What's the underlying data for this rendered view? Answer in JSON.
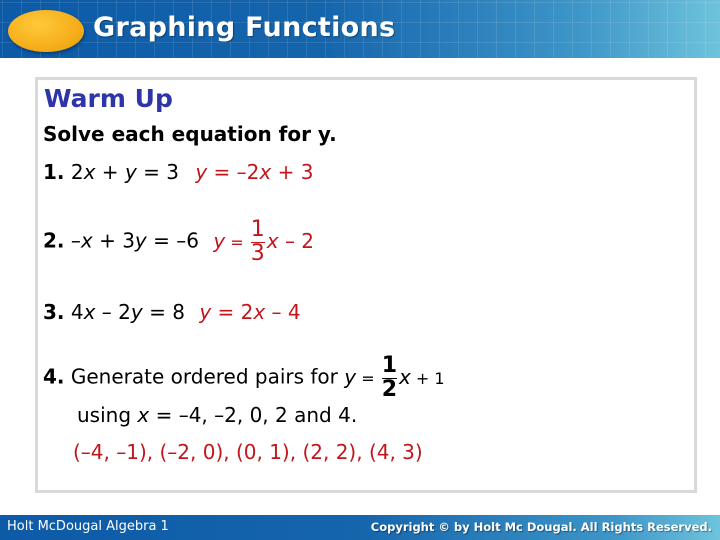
{
  "header": {
    "title": "Graphing Functions",
    "accent_color": "#f6ae1a",
    "bar_color": "#0d5aa7"
  },
  "content": {
    "heading": "Warm Up",
    "instruction": "Solve each equation for y.",
    "problems": [
      {
        "number": "1.",
        "equation": {
          "a": "2",
          "x": "x",
          "b": " + ",
          "y": "y",
          "c": " = 3"
        },
        "answer": {
          "y": "y",
          "rest": " = –2",
          "x": "x",
          "tail": " + 3"
        }
      },
      {
        "number": "2.",
        "equation": {
          "a": "–",
          "x": "x",
          "b": " + 3",
          "y": "y",
          "c": " = –6"
        },
        "answer": {
          "y": "y",
          "eq": " = ",
          "frac_num": "1",
          "frac_den": "3",
          "x": "x",
          "tail": " – 2"
        }
      },
      {
        "number": "3.",
        "equation": {
          "a": "4",
          "x": "x",
          "b": " – 2",
          "y": "y",
          "c": " = 8"
        },
        "answer": {
          "y": "y",
          "rest": " = 2",
          "x": "x",
          "tail": " – 4"
        }
      },
      {
        "number": "4.",
        "text": " Generate ordered pairs for ",
        "function": {
          "y": "y",
          "eq": " = ",
          "frac_num": "1",
          "frac_den": "2",
          "x": "x",
          "tail": " + 1"
        },
        "line2_pre": "using ",
        "line2_x": "x",
        "line2_post": " = –4, –2, 0, 2 and 4.",
        "answer": "(–4, –1), (–2, 0), (0, 1), (2, 2), (4, 3)"
      }
    ],
    "answer_color": "#c0161c",
    "heading_color": "#2e35a8"
  },
  "footer": {
    "left": "Holt McDougal Algebra 1",
    "right": "Copyright © by Holt Mc Dougal. All Rights Reserved."
  }
}
